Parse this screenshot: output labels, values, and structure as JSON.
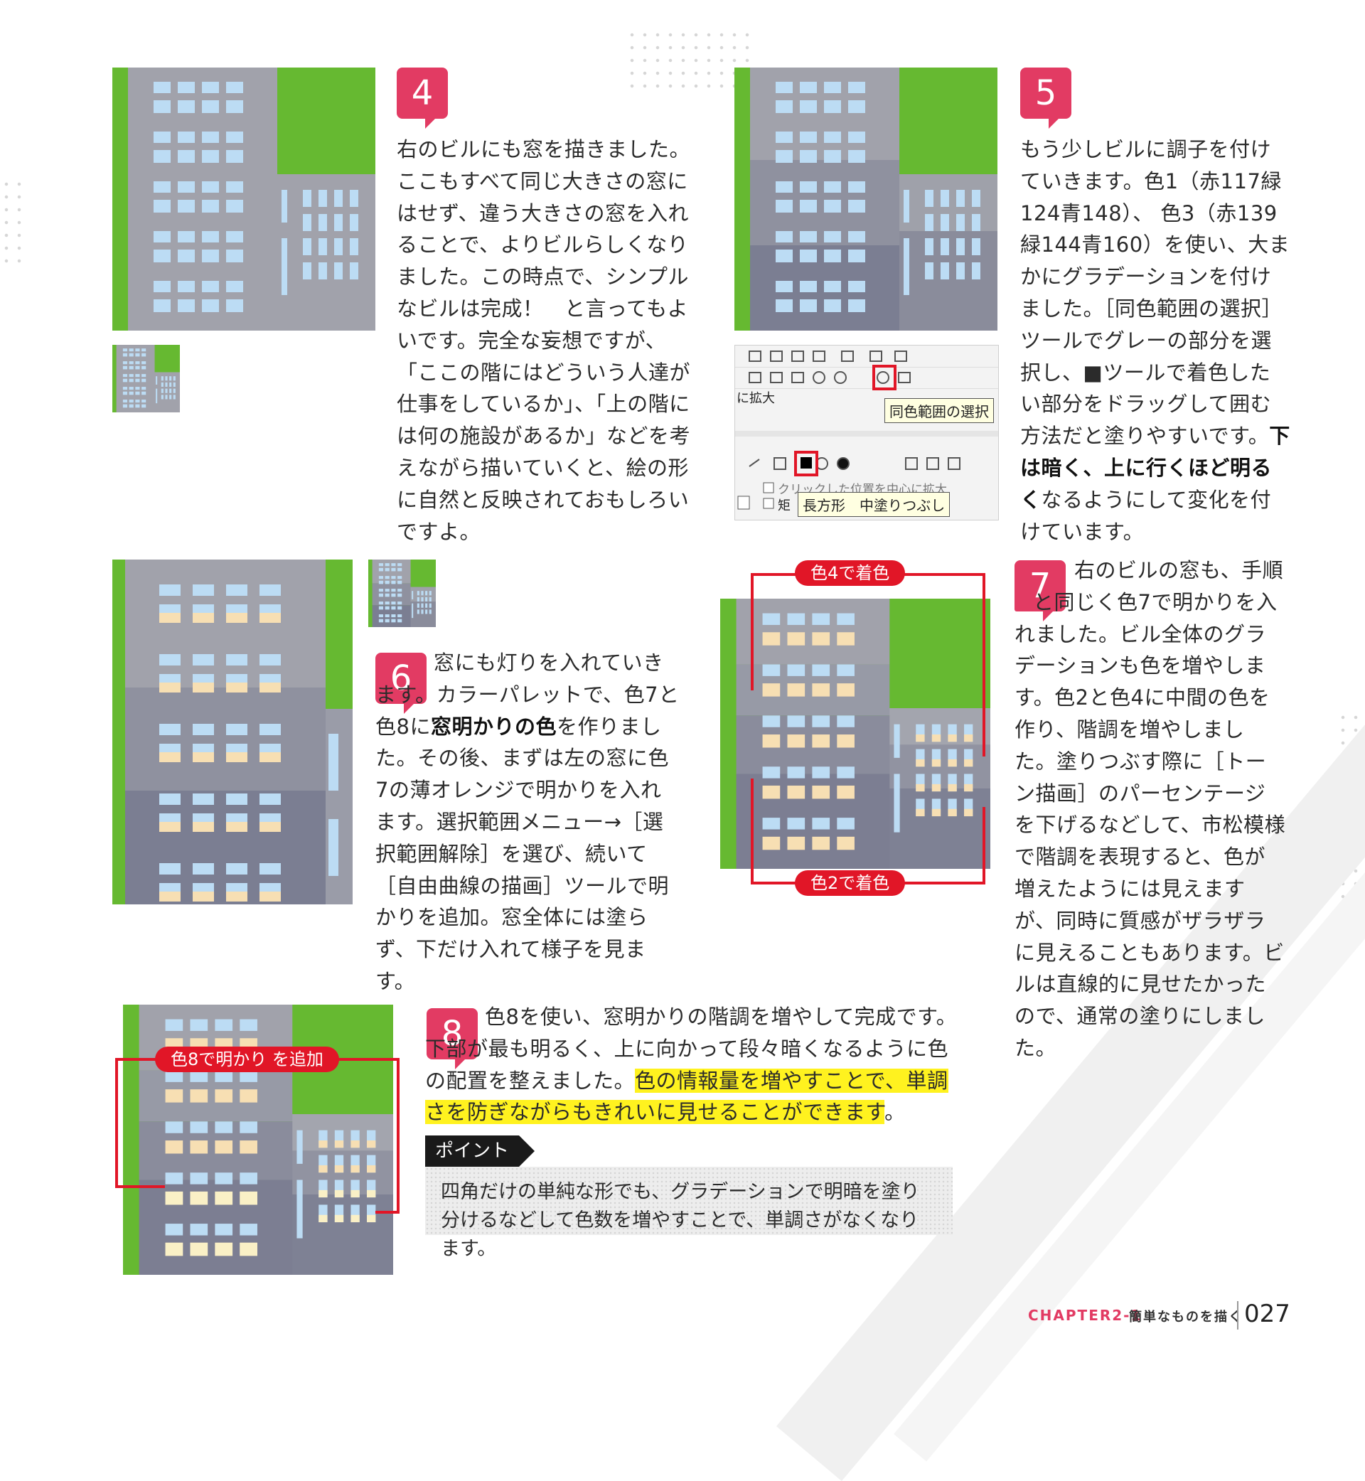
{
  "colors": {
    "accent": "#e23b63",
    "callout": "#e11627",
    "green": "#66b931",
    "highlight": "#fff21f"
  },
  "steps": [
    {
      "num": "4",
      "text": "右のビルにも窓を描きました。ここもすべて同じ大きさの窓にはせず、違う大きさの窓を入れることで、よりビルらしくなりました。この時点で、シンプルなビルは完成！　と言ってもよいです。完全な妄想ですが、「ここの階にはどういう人達が仕事をしているか」、「上の階には何の施設があるか」などを考えながら描いていくと、絵の形に自然と反映されておもしろいですよ。"
    },
    {
      "num": "5",
      "text_a": "もう少しビルに調子を付けていきます。色1（赤117緑124青148）、 色3（赤139緑144青160）を使い、大まかにグラデーションを付けました。［同色範囲の選択］ツールでグレーの部分を選択し、■ツールで着色したい部分をドラッグして囲む方法だと塗りやすいです。",
      "bold": "下は暗く、上に行くほど明るく",
      "text_b": "なるようにして変化を付けています。"
    },
    {
      "num": "6",
      "text_a": "窓にも灯りを入れていきます。カラーパレットで、色7と色8に",
      "bold": "窓明かりの色",
      "text_b": "を作りました。その後、まずは左の窓に色7の薄オレンジで明かりを入れます。選択範囲メニュー→［選択範囲解除］を選び、続いて［自由曲線の描画］ツールで明かりを追加。窓全体には塗らず、下だけ入れて様子を見ます。"
    },
    {
      "num": "7",
      "text_a": "右のビルの窓も、手順",
      "ref": "6",
      "text_b": "と同じく色7で明かりを入れました。ビル全体のグラデーションも色を増やします。色2と色4に中間の色を作り、階調を増やしました。塗りつぶす際に［トーン描画］のパーセンテージを下げるなどして、市松模様で階調を表現すると、色が増えたようには見えますが、同時に質感がザラザラに見えることもあります。ビルは直線的に見せたかったので、通常の塗りにしました。"
    },
    {
      "num": "8",
      "text_a": "色8を使い、窓明かりの階調を増やして完成です。下部が最も明るく、上に向かって段々暗くなるように色の配置を整えました。",
      "highlight": "色の情報量を増やすことで、単調さを防ぎながらもきれいに見せることができます",
      "text_b": "。"
    }
  ],
  "callouts": {
    "c4": "色4で着色",
    "c2": "色2で着色",
    "c8": "色8で明かり を追加"
  },
  "toolbox": {
    "menu_label": "に拡大",
    "tip_select": "同色範囲の選択",
    "check_label": "クリックした位置を中心に拡大",
    "rect_label": "矩",
    "tip_rect": "長方形　中塗りつぶし"
  },
  "point": {
    "label": "ポイント",
    "text": "四角だけの単純な形でも、グラデーションで明暗を塗り分けるなどして色数を増やすことで、単調さがなくなります。"
  },
  "footer": {
    "chapter": "CHAPTER2-1",
    "section": "簡単なものを描く",
    "page": "027"
  }
}
